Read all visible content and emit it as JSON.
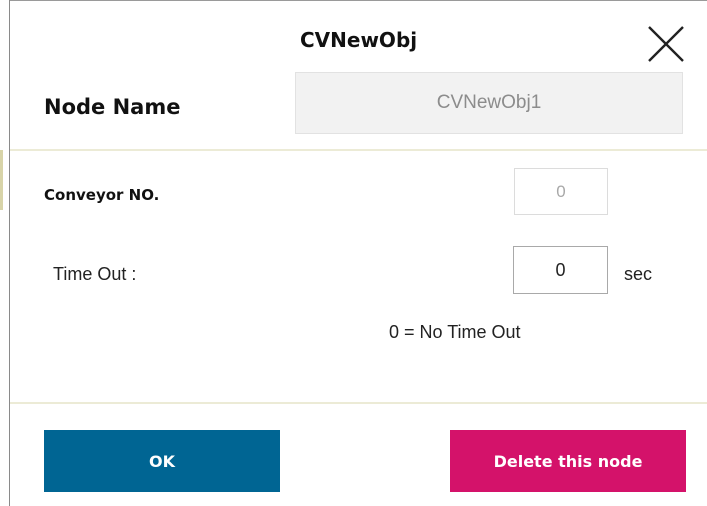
{
  "dialog": {
    "title": "CVNewObj"
  },
  "node_name": {
    "label": "Node Name",
    "value": "CVNewObj1"
  },
  "conveyor": {
    "label": "Conveyor NO.",
    "value": "0"
  },
  "timeout": {
    "label": "Time Out :",
    "value": "0",
    "unit": "sec",
    "hint": "0 = No Time Out"
  },
  "buttons": {
    "ok_label": "OK",
    "delete_label": "Delete this node"
  },
  "colors": {
    "ok_button": "#006593",
    "delete_button": "#d4126a",
    "input_bg": "#f2f2f2",
    "divider": "#ecebd6"
  },
  "icons": {
    "close": "close-icon"
  }
}
